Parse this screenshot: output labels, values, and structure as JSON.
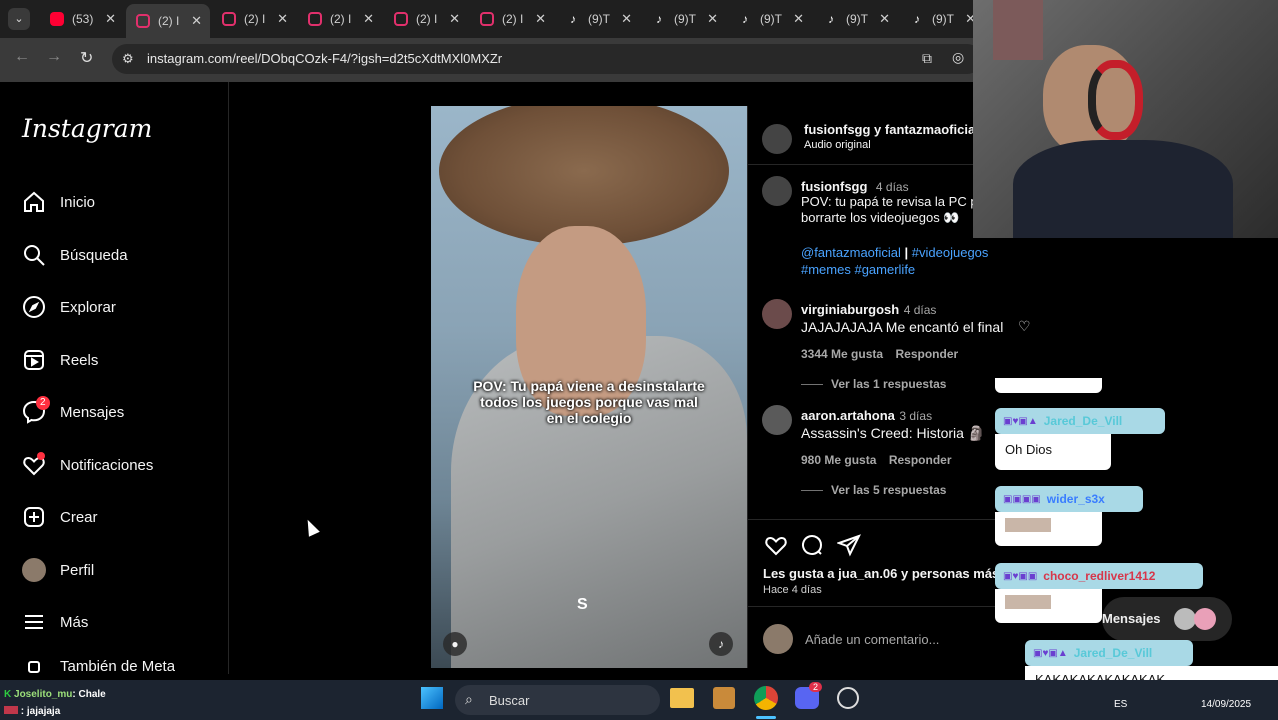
{
  "browser": {
    "tabs": [
      {
        "label": "(53)",
        "type": "youtube"
      },
      {
        "label": "(2) I",
        "type": "instagram",
        "active": true
      },
      {
        "label": "(2) I",
        "type": "instagram"
      },
      {
        "label": "(2) I",
        "type": "instagram"
      },
      {
        "label": "(2) I",
        "type": "instagram"
      },
      {
        "label": "(2) I",
        "type": "instagram"
      },
      {
        "label": "(9)T",
        "type": "tiktok"
      },
      {
        "label": "(9)T",
        "type": "tiktok"
      },
      {
        "label": "(9)T",
        "type": "tiktok"
      },
      {
        "label": "(9)T",
        "type": "tiktok"
      },
      {
        "label": "(9)T",
        "type": "tiktok"
      }
    ],
    "url": "instagram.com/reel/DObqCOzk-F4/?igsh=d2t5cXdtMXl0MXZr"
  },
  "sidebar": {
    "logo": "Instagram",
    "items": [
      {
        "label": "Inicio",
        "icon": "home-icon"
      },
      {
        "label": "Búsqueda",
        "icon": "search-icon"
      },
      {
        "label": "Explorar",
        "icon": "compass-icon"
      },
      {
        "label": "Reels",
        "icon": "reels-icon"
      },
      {
        "label": "Mensajes",
        "icon": "messenger-icon",
        "badge": "2"
      },
      {
        "label": "Notificaciones",
        "icon": "heart-icon"
      },
      {
        "label": "Crear",
        "icon": "plus-icon"
      },
      {
        "label": "Perfil",
        "icon": "avatar"
      },
      {
        "label": "Más",
        "icon": "menu-icon"
      },
      {
        "label": "También de Meta",
        "icon": "meta-icon"
      }
    ]
  },
  "reel": {
    "caption_overlay": "POV: Tu papá viene a desinstalarte todos los juegos porque vas mal en el colegio"
  },
  "post": {
    "header_users": "fusionfsgg y fantazmaoficial",
    "audio": "Audio original",
    "author": "fusionfsgg",
    "author_time": "4 días",
    "caption": "POV: tu papá te revisa la PC pa borrarte los videojuegos 👀",
    "tags_line1_a": "@fantazmaoficial",
    "tags_line1_sep": "|",
    "tags_line1_b": "#videojuegos",
    "tags_line2": "#memes #gamerlife",
    "comments": [
      {
        "user": "virginiaburgosh",
        "time": "4 días",
        "text": "JAJAJAJAJA Me encantó el final",
        "likes": "3344 Me gusta",
        "reply": "Responder",
        "view_replies": "Ver las 1 respuestas"
      },
      {
        "user": "aaron.artahona",
        "time": "3 días",
        "text": "Assassin's Creed: Historia 🗿",
        "likes": "980 Me gusta",
        "reply": "Responder",
        "view_replies": "Ver las 5 respuestas"
      }
    ],
    "likes_line": "Les gusta a jua_an.06 y personas más",
    "posted": "Hace 4 días",
    "add_comment": "Añade un comentario..."
  },
  "chat_overlay": {
    "messages": [
      {
        "name": "Jared_De_Vill",
        "text": "Oh Dios",
        "name_color": "#1aa7c0"
      },
      {
        "name": "wider_s3x",
        "text": "",
        "name_color": "#1a70ff"
      },
      {
        "name": "choco_redliver1412",
        "text": "",
        "name_color": "#e0304a"
      },
      {
        "name": "Jared_De_Vill",
        "text": "KAKAKAKAKAKAKAK",
        "name_color": "#1aa7c0"
      }
    ],
    "messages_label": "Mensajes"
  },
  "stream_chat": [
    {
      "user": "Joselito_mu",
      "text": ": Chale"
    },
    {
      "user": "",
      "text": ": jajajaja"
    }
  ],
  "taskbar": {
    "search_label": "Buscar",
    "lang": "ES",
    "date": "14/09/2025",
    "discord_badge": "2"
  }
}
